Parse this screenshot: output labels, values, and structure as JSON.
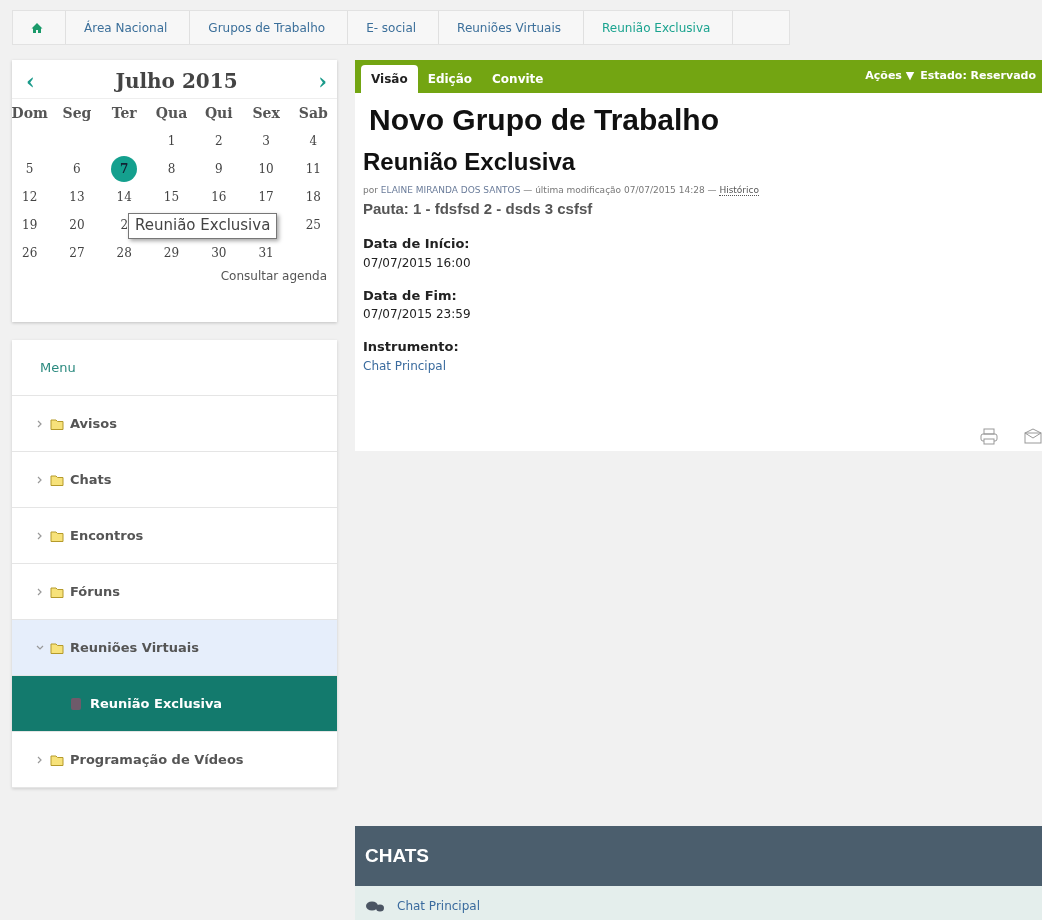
{
  "breadcrumb": [
    {
      "label": "Área Nacional",
      "current": false
    },
    {
      "label": "Grupos de Trabalho",
      "current": false
    },
    {
      "label": "E- social",
      "current": false
    },
    {
      "label": "Reuniões Virtuais",
      "current": false
    },
    {
      "label": "Reunião Exclusiva",
      "current": true
    }
  ],
  "calendar": {
    "prev": "‹",
    "title": "Julho 2015",
    "next": "›",
    "weekdays": [
      "Dom",
      "Seg",
      "Ter",
      "Qua",
      "Qui",
      "Sex",
      "Sab"
    ],
    "weeks": [
      {
        "days": [
          {
            "day": "1",
            "event": false
          },
          {
            "day": "2",
            "event": false
          },
          {
            "day": "3",
            "event": false
          },
          {
            "day": "4",
            "event": false
          }
        ]
      },
      {
        "days": [
          {
            "day": "5",
            "event": false
          },
          {
            "day": "6",
            "event": false
          },
          {
            "day": "7",
            "event": true
          },
          {
            "day": "8",
            "event": false
          },
          {
            "day": "9",
            "event": false
          },
          {
            "day": "10",
            "event": false
          },
          {
            "day": "11",
            "event": false
          }
        ]
      },
      {
        "days": [
          {
            "day": "12",
            "event": false
          },
          {
            "day": "13",
            "event": false
          },
          {
            "day": "14",
            "event": false
          },
          {
            "day": "15",
            "event": false
          },
          {
            "day": "16",
            "event": false
          },
          {
            "day": "17",
            "event": false
          },
          {
            "day": "18",
            "event": false
          }
        ]
      },
      {
        "days": [
          {
            "day": "19",
            "event": false
          },
          {
            "day": "20",
            "event": false
          },
          {
            "day": "2",
            "event": false
          }
        ],
        "end_days": [
          {
            "day": "25",
            "event": false
          }
        ]
      },
      {
        "days": [
          {
            "day": "26",
            "event": false
          },
          {
            "day": "27",
            "event": false
          },
          {
            "day": "28",
            "event": false
          },
          {
            "day": "29",
            "event": false
          },
          {
            "day": "30",
            "event": false
          },
          {
            "day": "31",
            "event": false
          }
        ]
      }
    ],
    "tooltip": "Reunião Exclusiva",
    "link": "Consultar agenda"
  },
  "menu": {
    "title": "Menu",
    "items": [
      {
        "label": "Avisos",
        "expanded": false
      },
      {
        "label": "Chats",
        "expanded": false
      },
      {
        "label": "Encontros",
        "expanded": false
      },
      {
        "label": "Fóruns",
        "expanded": false
      },
      {
        "label": "Reuniões Virtuais",
        "expanded": true,
        "children": [
          {
            "label": "Reunião Exclusiva",
            "selected": true
          }
        ]
      },
      {
        "label": "Programação de Vídeos",
        "expanded": false
      }
    ]
  },
  "tabs": [
    {
      "label": "Visão",
      "selected": true
    },
    {
      "label": "Edição",
      "selected": false
    },
    {
      "label": "Convite",
      "selected": false
    }
  ],
  "actions": {
    "label": "Ações",
    "caret": "▼",
    "state": "Estado: Reservado"
  },
  "group_title": "Novo Grupo de Trabalho",
  "title": "Reunião Exclusiva",
  "byline": {
    "prefix": "por",
    "author": "ELAINE MIRANDA DOS SANTOS",
    "modified": "— última modificação 07/07/2015 14:28 —",
    "history": "Histórico"
  },
  "agenda": "Pauta: 1 - fdsfsd 2 - dsds 3 csfsf",
  "fields": [
    {
      "label": "Data de Início:",
      "value": "07/07/2015 16:00",
      "kind": "text"
    },
    {
      "label": "Data de Fim:",
      "value": "07/07/2015 23:59",
      "kind": "text"
    },
    {
      "label": "Instrumento:",
      "value": "Chat Principal",
      "kind": "link"
    }
  ],
  "chats": {
    "title": "CHATS",
    "items": [
      "Chat Principal"
    ]
  }
}
